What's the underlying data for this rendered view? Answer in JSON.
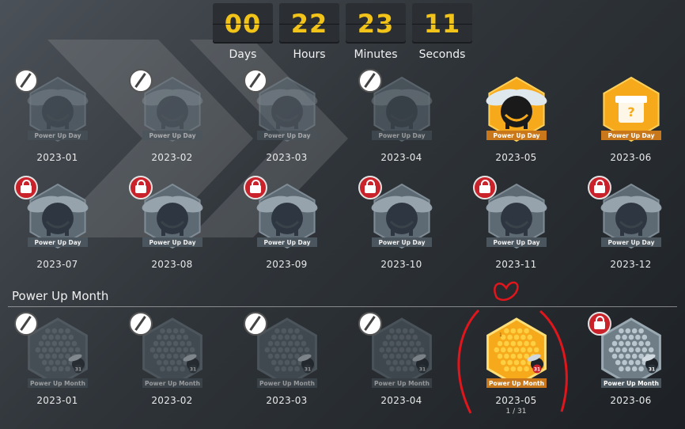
{
  "countdown": {
    "days": "00",
    "days_label": "Days",
    "hours": "22",
    "hours_label": "Hours",
    "minutes": "23",
    "minutes_label": "Minutes",
    "seconds": "11",
    "seconds_label": "Seconds"
  },
  "day_badges": [
    {
      "label": "2023-01",
      "state": "missed",
      "ribbon": "Power Up Day"
    },
    {
      "label": "2023-02",
      "state": "missed",
      "ribbon": "Power Up Day"
    },
    {
      "label": "2023-03",
      "state": "missed",
      "ribbon": "Power Up Day"
    },
    {
      "label": "2023-04",
      "state": "missed",
      "ribbon": "Power Up Day"
    },
    {
      "label": "2023-05",
      "state": "earned",
      "ribbon": "Power Up Day"
    },
    {
      "label": "2023-06",
      "state": "gift",
      "ribbon": "Power Up Day"
    },
    {
      "label": "2023-07",
      "state": "locked",
      "ribbon": "Power Up Day"
    },
    {
      "label": "2023-08",
      "state": "locked",
      "ribbon": "Power Up Day"
    },
    {
      "label": "2023-09",
      "state": "locked",
      "ribbon": "Power Up Day"
    },
    {
      "label": "2023-10",
      "state": "locked",
      "ribbon": "Power Up Day"
    },
    {
      "label": "2023-11",
      "state": "locked",
      "ribbon": "Power Up Day"
    },
    {
      "label": "2023-12",
      "state": "locked",
      "ribbon": "Power Up Day"
    }
  ],
  "month_section": {
    "title": "Power Up Month",
    "badges": [
      {
        "label": "2023-01",
        "state": "missed",
        "ribbon": "Power Up Month",
        "count": "31"
      },
      {
        "label": "2023-02",
        "state": "missed",
        "ribbon": "Power Up Month",
        "count": "31"
      },
      {
        "label": "2023-03",
        "state": "missed",
        "ribbon": "Power Up Month",
        "count": "31"
      },
      {
        "label": "2023-04",
        "state": "missed",
        "ribbon": "Power Up Month",
        "count": "31"
      },
      {
        "label": "2023-05",
        "state": "active",
        "ribbon": "Power Up Month",
        "count": "31",
        "progress": "1 / 31",
        "mini": "1"
      },
      {
        "label": "2023-06",
        "state": "locked",
        "ribbon": "Power Up Month",
        "count": "31"
      }
    ]
  },
  "colors": {
    "accent_yellow": "#f2c318",
    "gold_badge": "#f6a91b",
    "lock_red": "#c9222a",
    "annotation_red": "#e0161c"
  }
}
